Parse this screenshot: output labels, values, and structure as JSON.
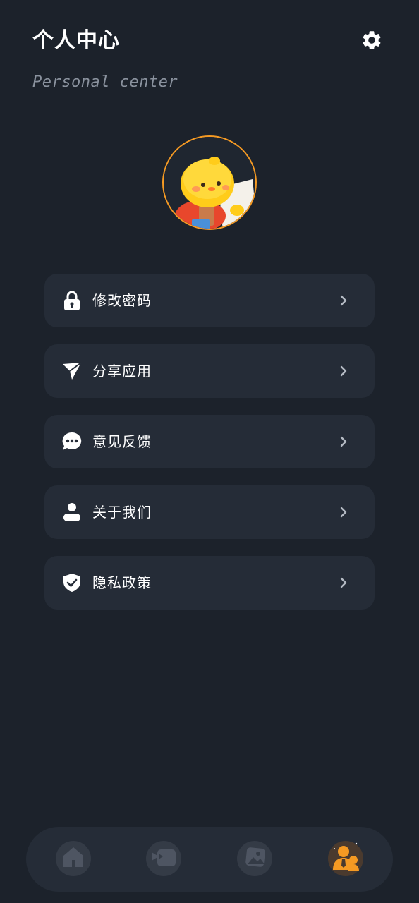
{
  "header": {
    "title": "个人中心",
    "subtitle": "Personal center",
    "settings_icon": "gear-icon"
  },
  "profile": {
    "avatar_icon": "chick-mascot-avatar",
    "avatar_border_color": "#f59a23"
  },
  "menu": {
    "items": [
      {
        "label": "修改密码",
        "icon": "lock-icon"
      },
      {
        "label": "分享应用",
        "icon": "paper-plane-icon"
      },
      {
        "label": "意见反馈",
        "icon": "chat-bubble-icon"
      },
      {
        "label": "关于我们",
        "icon": "person-icon"
      },
      {
        "label": "隐私政策",
        "icon": "shield-check-icon"
      }
    ]
  },
  "tabbar": {
    "items": [
      {
        "icon": "home-icon",
        "active": false
      },
      {
        "icon": "video-camera-icon",
        "active": false
      },
      {
        "icon": "image-icon",
        "active": false
      },
      {
        "icon": "user-profile-icon",
        "active": true
      }
    ],
    "active_color": "#f59a23"
  },
  "colors": {
    "background": "#1c222b",
    "card": "#252c37",
    "accent": "#f59a23",
    "subtitle": "#8a929e"
  }
}
